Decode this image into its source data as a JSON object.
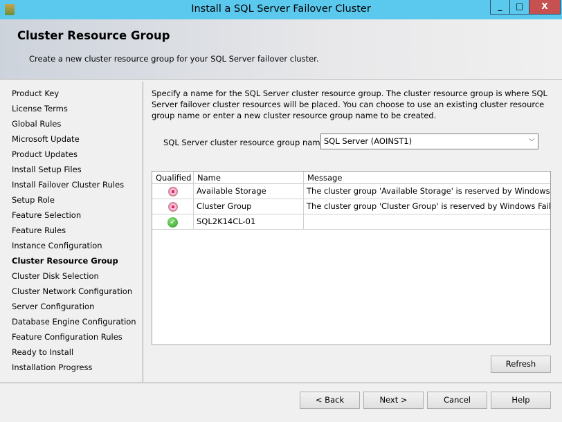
{
  "window": {
    "title": "Install a SQL Server Failover Cluster",
    "minimize": "_",
    "maximize": "□",
    "close": "X"
  },
  "header": {
    "title": "Cluster Resource Group",
    "subtitle": "Create a new cluster resource group for your SQL Server failover cluster."
  },
  "nav": {
    "active_index": 11,
    "items": [
      "Product Key",
      "License Terms",
      "Global Rules",
      "Microsoft Update",
      "Product Updates",
      "Install Setup Files",
      "Install Failover Cluster Rules",
      "Setup Role",
      "Feature Selection",
      "Feature Rules",
      "Instance Configuration",
      "Cluster Resource Group",
      "Cluster Disk Selection",
      "Cluster Network Configuration",
      "Server Configuration",
      "Database Engine Configuration",
      "Feature Configuration Rules",
      "Ready to Install",
      "Installation Progress"
    ]
  },
  "main": {
    "intro": "Specify a name for the SQL Server cluster resource group. The cluster resource group is where SQL Server failover cluster resources will be placed. You can choose to use an existing cluster resource group name or enter a new cluster resource group name to be created.",
    "group_label": "SQL Server cluster resource group name:",
    "group_value": "SQL Server (AOINST1)",
    "columns": [
      "Qualified",
      "Name",
      "Message"
    ],
    "rows": [
      {
        "qualified": "error",
        "name": "Available Storage",
        "message": "The cluster group 'Available Storage' is reserved by Windows Fai..."
      },
      {
        "qualified": "error",
        "name": "Cluster Group",
        "message": "The cluster group 'Cluster Group' is reserved by Windows Failov..."
      },
      {
        "qualified": "ok",
        "name": "SQL2K14CL-01",
        "message": ""
      }
    ],
    "refresh": "Refresh"
  },
  "footer": {
    "back": "< Back",
    "next": "Next >",
    "cancel": "Cancel",
    "help": "Help"
  }
}
